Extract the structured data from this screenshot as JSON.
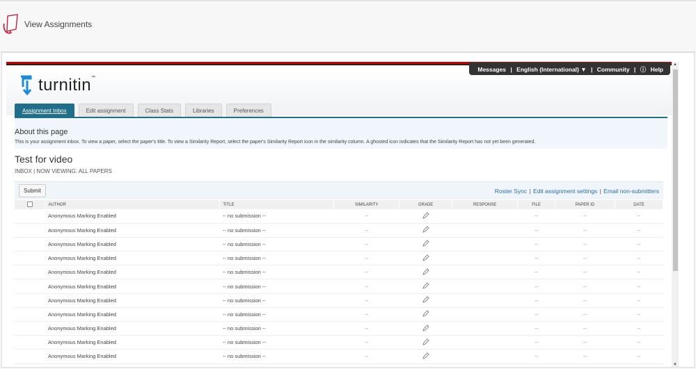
{
  "app": {
    "title": "View Assignments"
  },
  "utility_bar": {
    "messages": "Messages",
    "language": "English (International) ▼",
    "community": "Community",
    "help": "Help",
    "separator": "|"
  },
  "brand": {
    "name": "turnitin",
    "tm": "™"
  },
  "tabs": [
    {
      "label": "Assignment Inbox",
      "active": true
    },
    {
      "label": "Edit assignment",
      "active": false
    },
    {
      "label": "Class Stats",
      "active": false
    },
    {
      "label": "Libraries",
      "active": false
    },
    {
      "label": "Preferences",
      "active": false
    }
  ],
  "about": {
    "heading": "About this page",
    "text": "This is your assignment inbox. To view a paper, select the paper's title. To view a Similarity Report, select the paper's Similarity Report icon in the similarity column. A ghosted icon indicates that the Similarity Report has not yet been generated."
  },
  "assignment": {
    "title": "Test for video",
    "subtitle": "INBOX | NOW VIEWING: ALL PAPERS"
  },
  "toolbar": {
    "submit_label": "Submit",
    "roster_sync": "Roster Sync",
    "edit_settings": "Edit assignment settings",
    "email_non_submitters": "Email non-submitters",
    "separator": "|"
  },
  "table": {
    "headers": [
      "Author",
      "Title",
      "Similarity",
      "Grade",
      "Response",
      "File",
      "Paper ID",
      "Date"
    ],
    "rows": [
      {
        "author": "Anonymous Marking Enabled",
        "title": "-- no submission --",
        "similarity": "--",
        "response": "",
        "file": "--",
        "paper_id": "--",
        "date": "--"
      },
      {
        "author": "Anonymous Marking Enabled",
        "title": "-- no submission --",
        "similarity": "--",
        "response": "",
        "file": "--",
        "paper_id": "--",
        "date": "--"
      },
      {
        "author": "Anonymous Marking Enabled",
        "title": "-- no submission --",
        "similarity": "--",
        "response": "",
        "file": "--",
        "paper_id": "--",
        "date": "--"
      },
      {
        "author": "Anonymous Marking Enabled",
        "title": "-- no submission --",
        "similarity": "--",
        "response": "",
        "file": "--",
        "paper_id": "--",
        "date": "--"
      },
      {
        "author": "Anonymous Marking Enabled",
        "title": "-- no submission --",
        "similarity": "--",
        "response": "",
        "file": "--",
        "paper_id": "--",
        "date": "--"
      },
      {
        "author": "Anonymous Marking Enabled",
        "title": "-- no submission --",
        "similarity": "--",
        "response": "",
        "file": "--",
        "paper_id": "--",
        "date": "--"
      },
      {
        "author": "Anonymous Marking Enabled",
        "title": "-- no submission --",
        "similarity": "--",
        "response": "",
        "file": "--",
        "paper_id": "--",
        "date": "--"
      },
      {
        "author": "Anonymous Marking Enabled",
        "title": "-- no submission --",
        "similarity": "--",
        "response": "",
        "file": "--",
        "paper_id": "--",
        "date": "--"
      },
      {
        "author": "Anonymous Marking Enabled",
        "title": "-- no submission --",
        "similarity": "--",
        "response": "",
        "file": "--",
        "paper_id": "--",
        "date": "--"
      },
      {
        "author": "Anonymous Marking Enabled",
        "title": "-- no submission --",
        "similarity": "--",
        "response": "",
        "file": "--",
        "paper_id": "--",
        "date": "--"
      },
      {
        "author": "Anonymous Marking Enabled",
        "title": "-- no submission --",
        "similarity": "--",
        "response": "",
        "file": "--",
        "paper_id": "--",
        "date": "--"
      }
    ]
  },
  "colors": {
    "brand_teal": "#1f6f8b",
    "logo_blue": "#1a8bd6",
    "accent_red": "#cc0000",
    "link_blue": "#2a6fa8"
  }
}
